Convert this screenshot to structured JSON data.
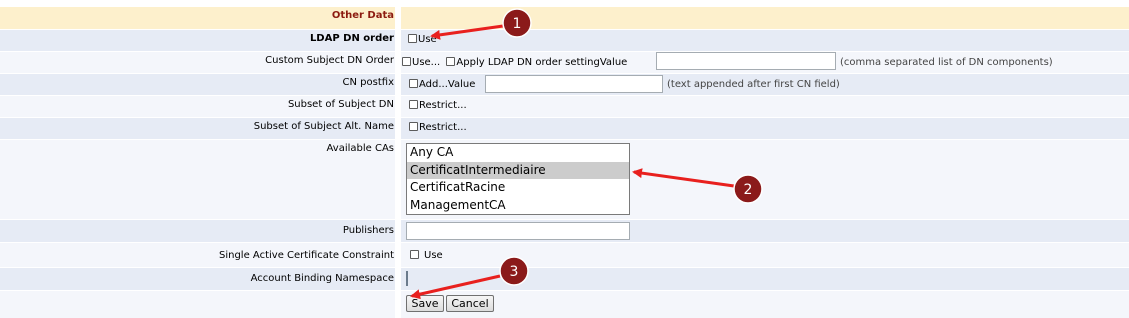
{
  "section_header": "Other Data",
  "ldap_dn_order": {
    "label": "LDAP DN order",
    "checkbox_label": "Use"
  },
  "custom_subject_dn_order": {
    "label": "Custom Subject DN Order",
    "use_label": "Use...",
    "apply_label": "Apply LDAP DN order setting",
    "value_label": "Value",
    "value": "",
    "hint": "(comma separated list of DN components)"
  },
  "cn_postfix": {
    "label": "CN postfix",
    "add_label": "Add...",
    "value_label": "Value",
    "value": "",
    "hint": "(text appended after first CN field)"
  },
  "subset_subject_dn": {
    "label": "Subset of Subject DN",
    "checkbox_label": "Restrict..."
  },
  "subset_subject_alt_name": {
    "label": "Subset of Subject Alt. Name",
    "checkbox_label": "Restrict..."
  },
  "available_cas": {
    "label": "Available CAs",
    "options": [
      "Any CA",
      "CertificatIntermediaire",
      "CertificatRacine",
      "ManagementCA"
    ],
    "selected": "CertificatIntermediaire"
  },
  "publishers": {
    "label": "Publishers",
    "value": ""
  },
  "single_active_cert": {
    "label": "Single Active Certificate Constraint",
    "checkbox_label": "Use"
  },
  "account_binding_namespace": {
    "label": "Account Binding Namespace"
  },
  "buttons": {
    "save": "Save",
    "cancel": "Cancel"
  },
  "annotations": {
    "marker1": "1",
    "marker2": "2",
    "marker3": "3"
  },
  "colors": {
    "header_bg": "#fdf0cc",
    "header_text": "#8c1b10",
    "row_a": "#e6ebf5",
    "row_b": "#f4f6fb",
    "marker": "#8b1a1a",
    "arrow": "#e8201e"
  }
}
